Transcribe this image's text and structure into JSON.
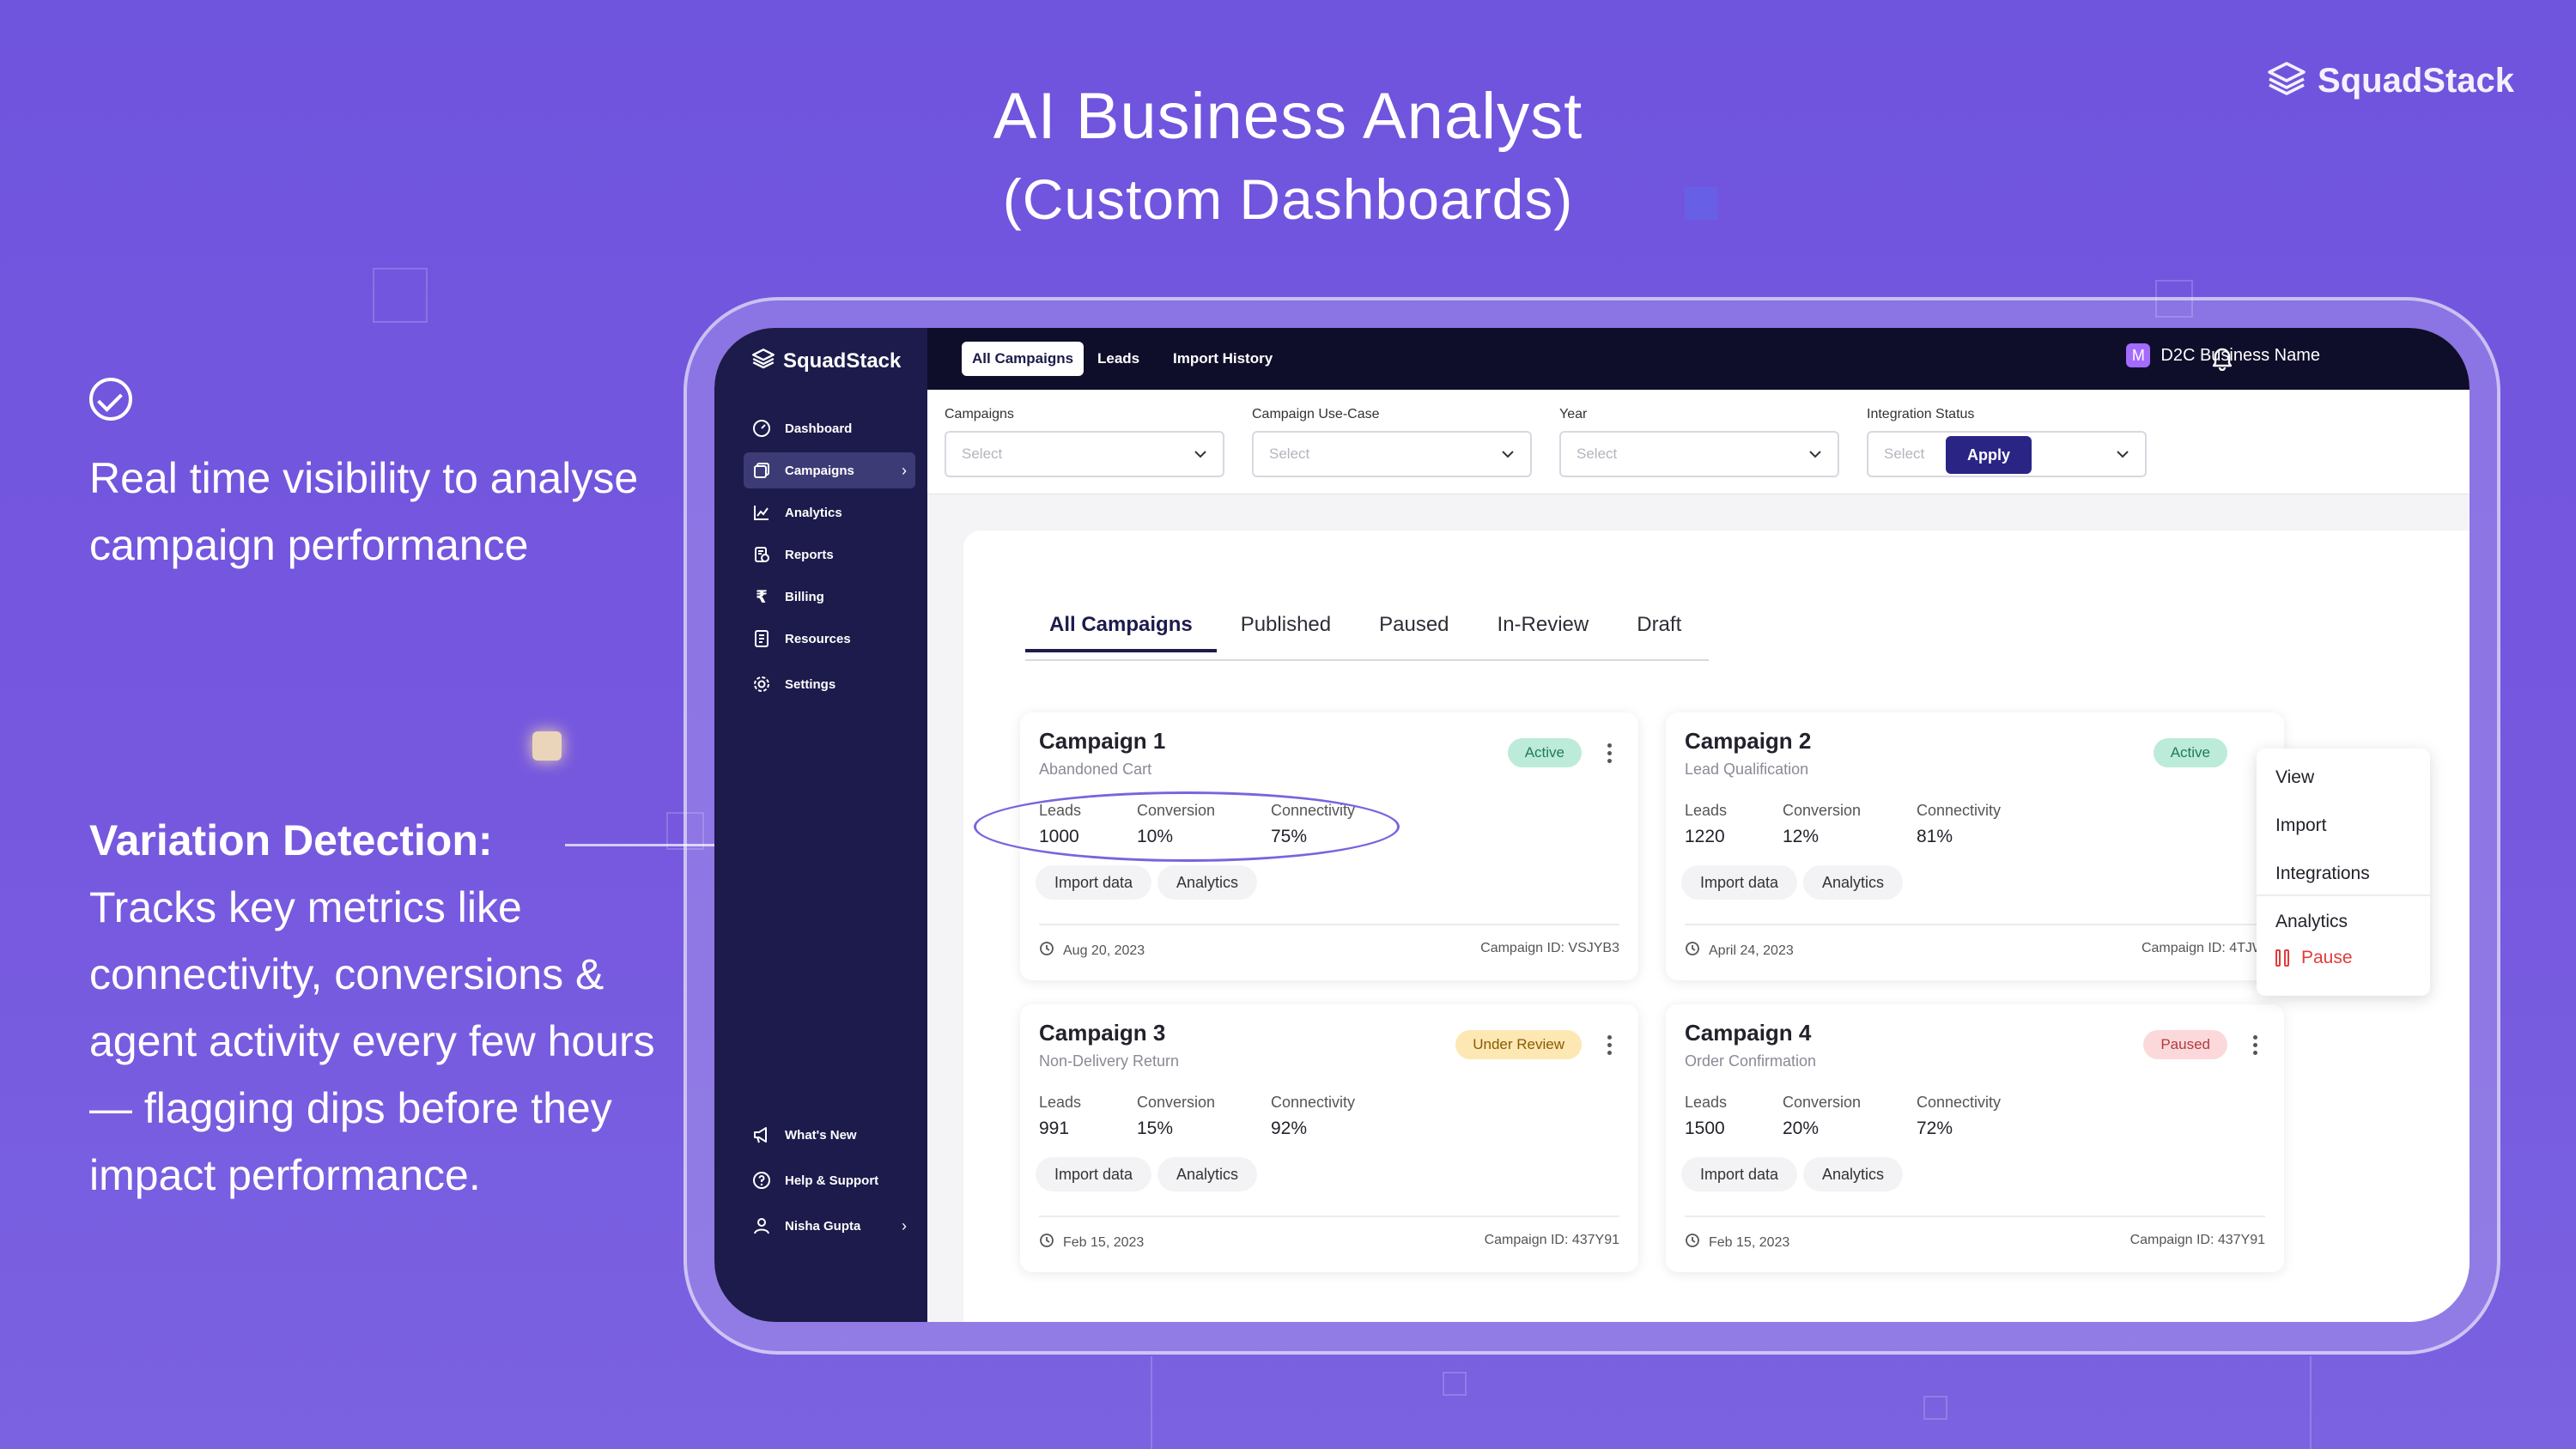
{
  "hero": {
    "title": "AI Business Analyst",
    "subtitle": "(Custom Dashboards)"
  },
  "brand": {
    "name": "SquadStack"
  },
  "copy": {
    "point1": "Real time visibility to analyse campaign performance",
    "point2_title": "Variation Detection:",
    "point2_body": "Tracks key metrics like connectivity, conversions & agent activity every few hours — flagging dips before they impact performance."
  },
  "app": {
    "logo": "SquadStack",
    "sidebar": {
      "items": [
        {
          "label": "Dashboard",
          "icon": "dashboard-icon"
        },
        {
          "label": "Campaigns",
          "icon": "campaigns-icon"
        },
        {
          "label": "Analytics",
          "icon": "analytics-icon"
        },
        {
          "label": "Reports",
          "icon": "reports-icon"
        },
        {
          "label": "Billing",
          "icon": "rupee-icon"
        },
        {
          "label": "Resources",
          "icon": "resources-icon"
        },
        {
          "label": "Settings",
          "icon": "gear-icon"
        }
      ],
      "bottom": [
        {
          "label": "What's New",
          "icon": "megaphone-icon"
        },
        {
          "label": "Help & Support",
          "icon": "help-icon"
        },
        {
          "label": "Nisha Gupta",
          "icon": "user-icon"
        }
      ]
    },
    "topbar": {
      "tabs": [
        "All Campaigns",
        "Leads",
        "Import History"
      ],
      "business_initial": "M",
      "business_name": "D2C Business Name"
    },
    "filters": [
      {
        "label": "Campaigns",
        "placeholder": "Select"
      },
      {
        "label": "Campaign Use-Case",
        "placeholder": "Select"
      },
      {
        "label": "Year",
        "placeholder": "Select"
      },
      {
        "label": "Integration Status",
        "placeholder": "Select"
      }
    ],
    "apply_label": "Apply",
    "tabs": [
      "All Campaigns",
      "Published",
      "Paused",
      "In-Review",
      "Draft"
    ],
    "metric_labels": {
      "leads": "Leads",
      "conversion": "Conversion",
      "connectivity": "Connectivity"
    },
    "chips": {
      "import": "Import data",
      "analytics": "Analytics"
    },
    "campaigns": [
      {
        "title": "Campaign 1",
        "subtitle": "Abandoned Cart",
        "status": "Active",
        "leads": "1000",
        "conversion": "10%",
        "connectivity": "75%",
        "date": "Aug 20, 2023",
        "campaign_id": "Campaign ID: VSJYB3"
      },
      {
        "title": "Campaign 2",
        "subtitle": "Lead Qualification",
        "status": "Active",
        "leads": "1220",
        "conversion": "12%",
        "connectivity": "81%",
        "date": "April 24, 2023",
        "campaign_id": "Campaign ID: 4TJW"
      },
      {
        "title": "Campaign 3",
        "subtitle": "Non-Delivery Return",
        "status": "Under Review",
        "leads": "991",
        "conversion": "15%",
        "connectivity": "92%",
        "date": "Feb 15, 2023",
        "campaign_id": "Campaign ID: 437Y91"
      },
      {
        "title": "Campaign 4",
        "subtitle": "Order Confirmation",
        "status": "Paused",
        "leads": "1500",
        "conversion": "20%",
        "connectivity": "72%",
        "date": "Feb 15, 2023",
        "campaign_id": "Campaign ID: 437Y91"
      }
    ],
    "menu": [
      "View",
      "Import",
      "Integrations",
      "Analytics"
    ],
    "menu_pause": "Pause"
  }
}
